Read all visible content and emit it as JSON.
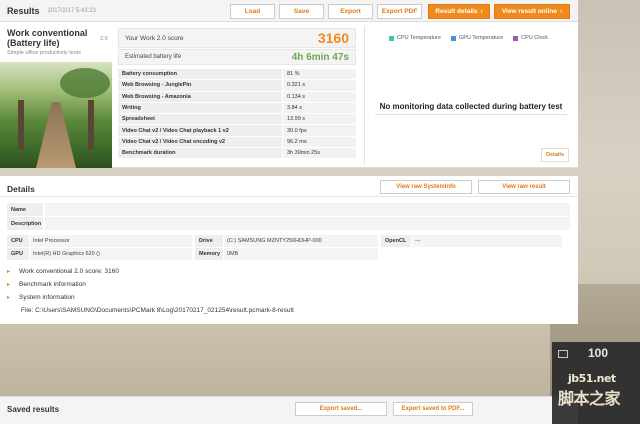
{
  "header": {
    "title": "Results",
    "date": "2017/2/17 5:43:23",
    "buttons": {
      "load": "Load",
      "save": "Save",
      "export": "Export",
      "export_pdf": "Export PDF",
      "result_details": "Result details",
      "view_online": "View result online"
    }
  },
  "test": {
    "name_line1": "Work conventional",
    "name_line2": "(Battery life)",
    "subtitle": "Simple office productivity tests",
    "version": "2.0"
  },
  "score": {
    "label": "Your Work 2.0 score",
    "value": "3160",
    "battery_label": "Estimated battery life",
    "battery_value": "4h 6min 47s"
  },
  "subscores": [
    {
      "key": "Battery consumption",
      "value": "81 %"
    },
    {
      "key": "Web Browsing - JunglePin",
      "value": "0.321 s"
    },
    {
      "key": "Web Browsing - Amazonia",
      "value": "0.134 s"
    },
    {
      "key": "Writing",
      "value": "3.84 s"
    },
    {
      "key": "Spreadsheet",
      "value": "13.99 s"
    },
    {
      "key": "Video Chat v2 / Video Chat playback 1 v2",
      "value": "30.0 fps"
    },
    {
      "key": "Video Chat v2 / Video Chat encoding v2",
      "value": "96.2 ms"
    },
    {
      "key": "Benchmark duration",
      "value": "3h 30min 25s"
    }
  ],
  "monitoring": {
    "legend": [
      {
        "label": "CPU Temperature",
        "color": "#3cc8b4"
      },
      {
        "label": "GPU Temperature",
        "color": "#4a90d9"
      },
      {
        "label": "CPU Clock",
        "color": "#9b59b6"
      }
    ],
    "no_data": "No monitoring data collected during battery test",
    "details_btn": "Details"
  },
  "details": {
    "title": "Details",
    "view_sysinfo": "View raw SystemInfo",
    "view_result": "View raw result",
    "name_label": "Name",
    "desc_label": "Description",
    "cpu_label": "CPU",
    "cpu_value": "Intel Processor",
    "gpu_label": "GPU",
    "gpu_value": "Intel(R) HD Graphics 620 ()",
    "drive_label": "Drive",
    "drive_value": "(C:) SAMSUNG MZNTY256HDHP-000",
    "memory_label": "Memory",
    "memory_value": "0MB",
    "opencl_label": "OpenCL",
    "opencl_value": "---",
    "expanders": [
      "Work conventional 2.0 score: 3160",
      "Benchmark information",
      "System information"
    ],
    "file": "File: C:\\Users\\SAMSUNG\\Documents\\PCMark 8\\Log\\20170217_021254\\result.pcmark-8-result"
  },
  "saved": {
    "title": "Saved results",
    "export_saved": "Export saved...",
    "export_pdf": "Export saved to PDF..."
  },
  "overlay": {
    "number": "100",
    "watermark": "脚本之家",
    "site": "jb51.net"
  }
}
